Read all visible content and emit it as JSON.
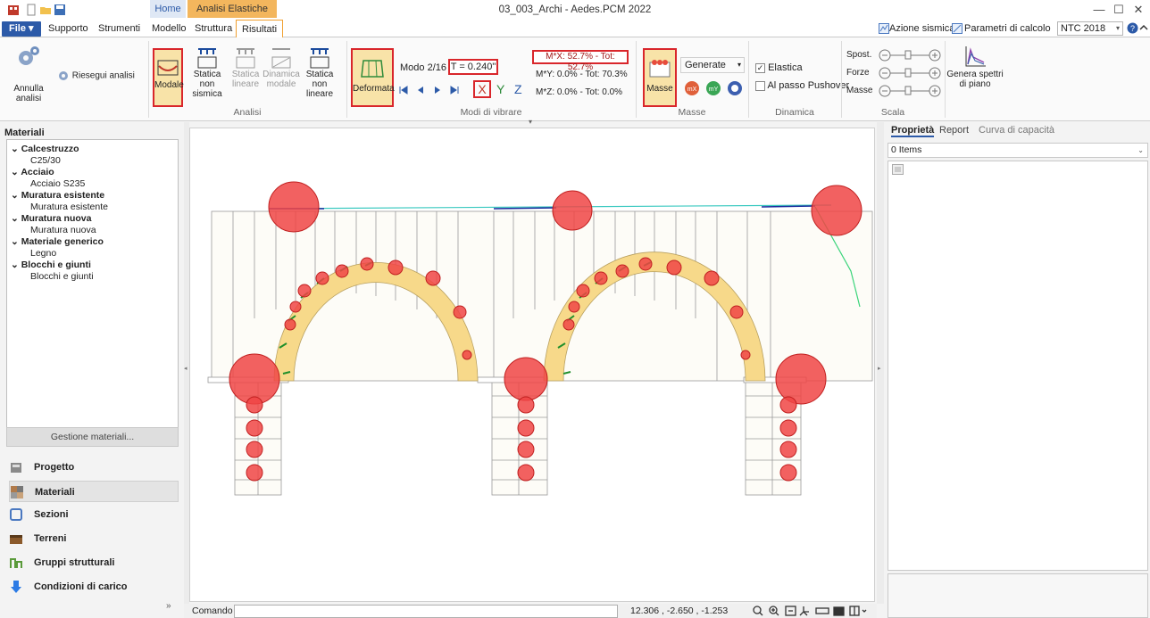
{
  "window": {
    "title": "03_003_Archi - Aedes.PCM 2022",
    "minimize": "—",
    "maximize": "☐",
    "close": "✕"
  },
  "context_tabs": {
    "home": "Home",
    "analisi": "Analisi Elastiche"
  },
  "menu": {
    "file": "File ▾",
    "tabs": [
      "Supporto",
      "Strumenti",
      "Modello",
      "Struttura",
      "Risultati"
    ]
  },
  "topright": {
    "azione_sismica": "Azione sismica",
    "parametri": "Parametri di calcolo",
    "norma": "NTC 2018"
  },
  "ribbon": {
    "annulla": "Annulla analisi",
    "riesegui": "Riesegui analisi",
    "modale": "Modale",
    "statica_non_sismica": [
      "Statica",
      "non sismica"
    ],
    "statica_lineare": [
      "Statica",
      "lineare"
    ],
    "dinamica_modale": [
      "Dinamica",
      "modale"
    ],
    "statica_non_lineare": [
      "Statica",
      "non lineare"
    ],
    "analisi_label": "Analisi",
    "deformata": "Deformata",
    "modo": "Modo 2/16",
    "periodo": "T = 0.240\"",
    "axes": [
      "X",
      "Y",
      "Z"
    ],
    "mx": "M*X: 52.7% - Tot: 52.7%",
    "my": "M*Y: 0.0% - Tot: 70.3%",
    "mz": "M*Z: 0.0% - Tot: 0.0%",
    "modi_label": "Modi di vibrare",
    "masse": "Masse",
    "generate": "Generate",
    "masse_label": "Masse",
    "elastica": "Elastica",
    "pushover": "Al passo Pushover",
    "dinamica_label": "Dinamica",
    "spost": "Spost.",
    "forze": "Forze",
    "masse_s": "Masse",
    "scala_label": "Scala",
    "genera_spettri": [
      "Genera spettri",
      "di piano"
    ]
  },
  "left": {
    "title": "Materiali",
    "tree": [
      {
        "label": "Calcestruzzo",
        "child": "C25/30"
      },
      {
        "label": "Acciaio",
        "child": "Acciaio S235"
      },
      {
        "label": "Muratura esistente",
        "child": "Muratura esistente"
      },
      {
        "label": "Muratura nuova",
        "child": "Muratura nuova"
      },
      {
        "label": "Materiale generico",
        "child": "Legno"
      },
      {
        "label": "Blocchi e giunti",
        "child": "Blocchi e giunti"
      }
    ],
    "gestione": "Gestione materiali...",
    "nav": [
      "Progetto",
      "Materiali",
      "Sezioni",
      "Terreni",
      "Gruppi strutturali",
      "Condizioni di carico"
    ]
  },
  "right": {
    "tabs": [
      "Proprietà",
      "Report",
      "Curva di capacità"
    ],
    "items": "0 Items"
  },
  "status": {
    "comando": "Comando",
    "coords": "12.306 , -2.650 , -1.253"
  },
  "colors": {
    "accent": "#2c5aa8",
    "context": "#f3b65d",
    "highlight": "#d9262b",
    "mass": "#f04545",
    "arch": "#f7d98a"
  }
}
